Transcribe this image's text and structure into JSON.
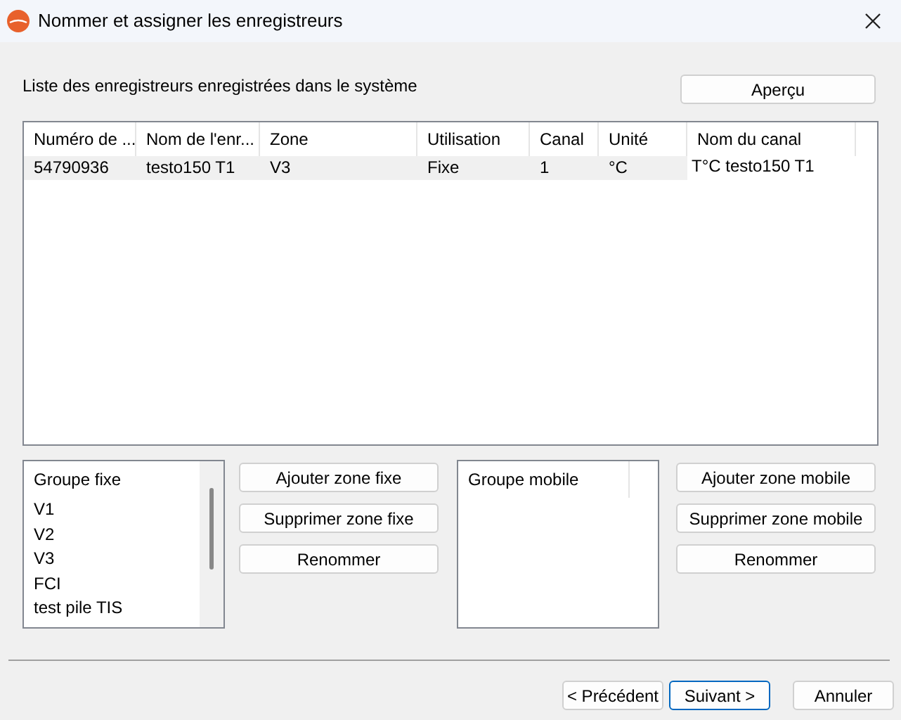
{
  "window": {
    "title": "Nommer et assigner les enregistreurs"
  },
  "list_label": "Liste des enregistreurs enregistrées dans le système",
  "preview_button": "Aperçu",
  "table": {
    "columns": [
      "Numéro de ...",
      "Nom de l'enr...",
      "Zone",
      "Utilisation",
      "Canal",
      "Unité",
      "Nom du canal"
    ],
    "rows": [
      {
        "cells": [
          "54790936",
          "testo150 T1",
          "V3",
          "Fixe",
          "1",
          "°C",
          "T°C testo150 T1"
        ],
        "selected": true
      }
    ]
  },
  "fixed_group": {
    "header": "Groupe fixe",
    "items": [
      "V1",
      "V2",
      "V3",
      "FCI",
      "test pile TIS"
    ],
    "buttons": [
      "Ajouter zone fixe",
      "Supprimer zone fixe",
      "Renommer"
    ]
  },
  "mobile_group": {
    "header": "Groupe mobile",
    "buttons": [
      "Ajouter zone mobile",
      "Supprimer zone mobile",
      "Renommer"
    ]
  },
  "footer_buttons": [
    {
      "label": "< Précédent",
      "default": false
    },
    {
      "label": "Suivant >",
      "default": true
    },
    {
      "label": "Annuler",
      "default": false
    }
  ]
}
